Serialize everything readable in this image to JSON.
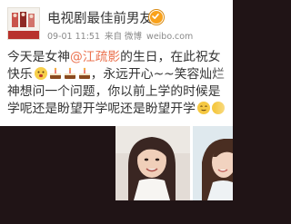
{
  "post": {
    "account_name": "电视剧最佳前男友",
    "date": "09-01 11:51",
    "source": "来自 微博",
    "site": "weibo.com",
    "text_lines": [
      [
        "今天是女神",
        "@江疏影",
        "的生日，在此祝女"
      ],
      [
        "快乐",
        "",
        ""
      ],
      [
        "",
        "",
        "，永远开心~~笑容灿烂"
      ],
      [
        "神想问一个问题，你以前上学的时候是"
      ],
      [
        "学呢还是盼望开学呢还是盼望开学"
      ]
    ],
    "line1_prefix": "今天是女神",
    "line1_mention": "@江疏影",
    "line1_suffix": "的生日，在此祝女",
    "line2_prefix": "快乐",
    "line2_suffix": "，永远开心~~笑容灿烂",
    "line3": "神想问一个问题，你以前上学的时候是",
    "line4": "学呢还是盼望开学呢还是盼望开学"
  },
  "icons": {
    "verified": "verified-badge-icon",
    "emoji": "face-emoji-icon",
    "cake": "cake-emoji-icon"
  },
  "colors": {
    "mention": "#eb7350",
    "verified": "#f9a21c",
    "brand_red": "#b8322c"
  }
}
